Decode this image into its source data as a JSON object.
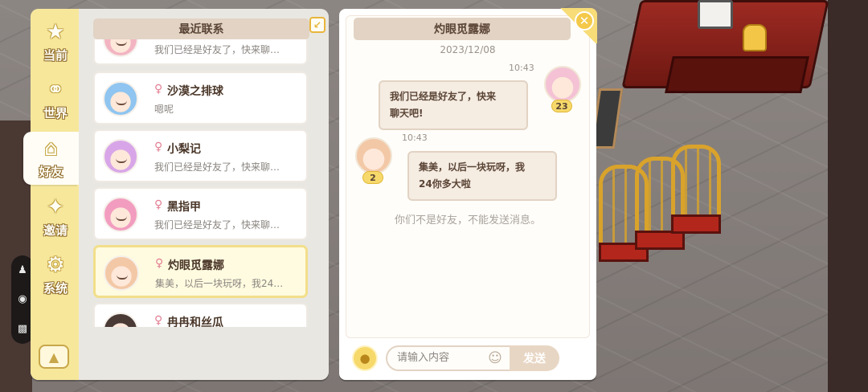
{
  "colors": {
    "tab_bar": "#f6e79b",
    "header_bg": "#e2d3c4",
    "active_item_bg": "#fffbe0",
    "female_icon": "#e27f93",
    "accent_gold": "#f4c94a"
  },
  "sidebar": {
    "tabs": [
      {
        "label": "当前",
        "icon": "star-icon"
      },
      {
        "label": "世界",
        "icon": "planet-icon"
      },
      {
        "label": "好友",
        "icon": "house-icon",
        "active": true
      },
      {
        "label": "邀请",
        "icon": "invite-icon"
      },
      {
        "label": "系统",
        "icon": "system-icon"
      }
    ],
    "bottom_button_icon": "shirt-icon"
  },
  "contacts": {
    "header": "最近联系",
    "items": [
      {
        "name": "",
        "last_message": "我们已经是好友了，快来聊…",
        "gender": "♀",
        "hair": "#f3b4c2"
      },
      {
        "name": "沙漠之排球",
        "last_message": "嗯呢",
        "gender": "♀",
        "hair": "#8fc5f0"
      },
      {
        "name": "小梨记",
        "last_message": "我们已经是好友了，快来聊…",
        "gender": "♀",
        "hair": "#d8a6e8"
      },
      {
        "name": "黑指甲",
        "last_message": "我们已经是好友了，快来聊…",
        "gender": "♀",
        "hair": "#f29dbf"
      },
      {
        "name": "灼眼觅露娜",
        "last_message": "集美，以后一块玩呀，我24…",
        "gender": "♀",
        "hair": "#f3c8a6",
        "active": true
      },
      {
        "name": "冉冉和丝瓜",
        "last_message": "",
        "gender": "♀",
        "hair": "#4a3a36"
      }
    ]
  },
  "chat": {
    "title": "灼眼觅露娜",
    "date": "2023/12/08",
    "messages": [
      {
        "side": "right",
        "time": "10:43",
        "text_line1": "我们已经是好友了，快来",
        "text_line2": "聊天吧!",
        "level": "23"
      },
      {
        "side": "left",
        "time": "10:43",
        "text_line1": "集美，以后一块玩呀，我",
        "text_line2": "24你多大啦",
        "level": "2"
      }
    ],
    "notice": "你们不是好友，不能发送消息。",
    "input_placeholder": "请输入内容",
    "send_label": "发送"
  },
  "side_controls": {
    "icons": [
      "person-icon",
      "eye-icon",
      "screen-icon"
    ]
  }
}
